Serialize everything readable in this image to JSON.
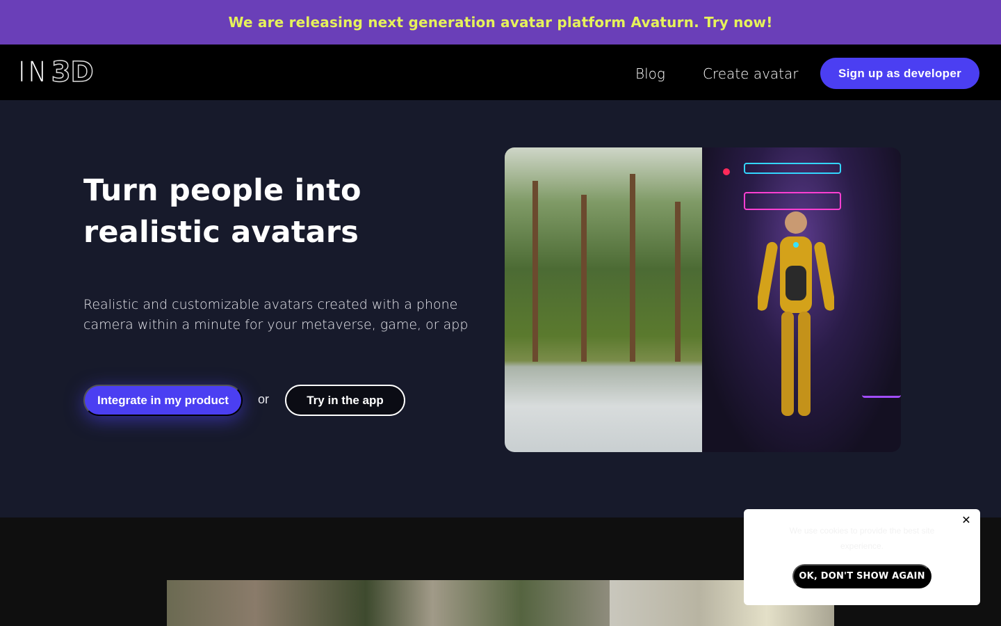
{
  "announcement": {
    "text": "We are releasing next generation avatar platform Avaturn. Try now!"
  },
  "nav": {
    "logo_in": "IN",
    "logo_3d": "3D",
    "links": [
      "Blog",
      "Create avatar"
    ],
    "cta": "Sign up as developer"
  },
  "hero": {
    "title": "Turn people into realistic avatars",
    "subtitle": "Realistic and customizable avatars created with a phone camera within a minute for your metaverse, game, or app",
    "primary_button": "Integrate in my product",
    "or_text": "or",
    "secondary_button": "Try in the app"
  },
  "cookie": {
    "message": "We use cookies to provide the best site experience.",
    "button": "OK, DON'T SHOW AGAIN",
    "close_icon": "close-icon"
  },
  "colors": {
    "accent": "#4b3ff2",
    "announcement_bg": "#6a3fb8",
    "announcement_text": "#e6f25a",
    "hero_bg": "#171a2b"
  }
}
